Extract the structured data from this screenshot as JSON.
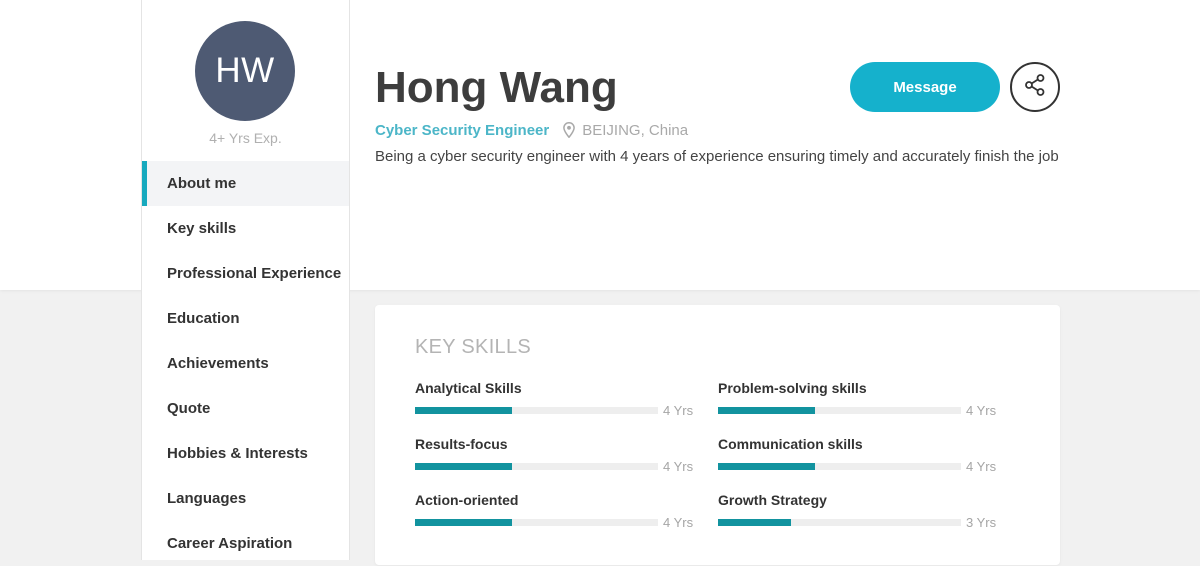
{
  "profile": {
    "initials": "HW",
    "experience": "4+ Yrs Exp.",
    "name": "Hong Wang",
    "role": "Cyber Security Engineer",
    "location": "BEIJING, China",
    "bio": "Being a cyber security engineer with 4 years of experience ensuring timely and accurately finish the job"
  },
  "actions": {
    "message_label": "Message"
  },
  "sidebar": {
    "items": [
      {
        "label": "About me",
        "active": true
      },
      {
        "label": "Key skills",
        "active": false
      },
      {
        "label": "Professional Experience",
        "active": false
      },
      {
        "label": "Education",
        "active": false
      },
      {
        "label": "Achievements",
        "active": false
      },
      {
        "label": "Quote",
        "active": false
      },
      {
        "label": "Hobbies & Interests",
        "active": false
      },
      {
        "label": "Languages",
        "active": false
      },
      {
        "label": "Career Aspiration",
        "active": false
      }
    ]
  },
  "skills": {
    "title": "KEY SKILLS",
    "items": [
      {
        "name": "Analytical Skills",
        "years": "4 Yrs",
        "level": 0.4
      },
      {
        "name": "Problem-solving skills",
        "years": "4 Yrs",
        "level": 0.4
      },
      {
        "name": "Results-focus",
        "years": "4 Yrs",
        "level": 0.4
      },
      {
        "name": "Communication skills",
        "years": "4 Yrs",
        "level": 0.4
      },
      {
        "name": "Action-oriented",
        "years": "4 Yrs",
        "level": 0.4
      },
      {
        "name": "Growth Strategy",
        "years": "3 Yrs",
        "level": 0.3
      }
    ]
  },
  "colors": {
    "accent": "#15b1cc",
    "bar_fill": "#12939f",
    "avatar_bg": "#4e5a73",
    "role_text": "#4cb6c8"
  },
  "icons": {
    "location": "map-pin-icon",
    "share": "share-icon"
  }
}
